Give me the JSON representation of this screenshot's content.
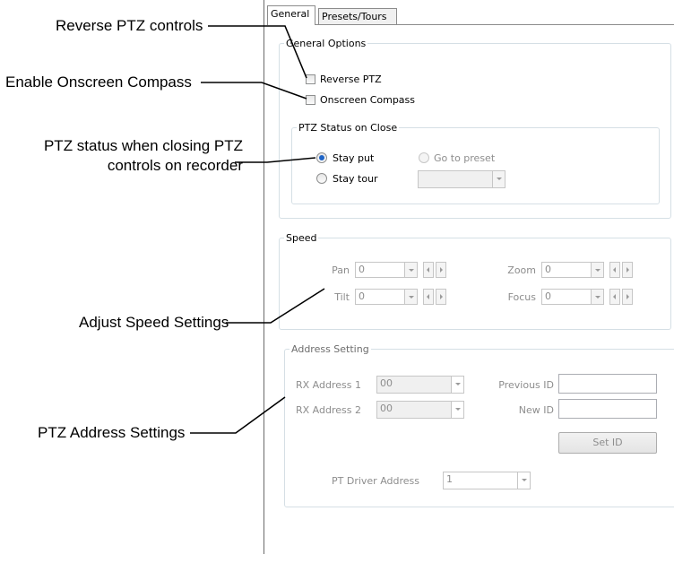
{
  "tabs": [
    {
      "label": "General",
      "active": true
    },
    {
      "label": "Presets/Tours",
      "active": false
    }
  ],
  "callouts": {
    "reverse_ptz": "Reverse PTZ controls",
    "compass": "Enable Onscreen Compass",
    "status_line1": "PTZ status when closing PTZ",
    "status_line2": "controls on recorder",
    "speed": "Adjust Speed Settings",
    "address": "PTZ Address Settings"
  },
  "general_options": {
    "title": "General Options",
    "reverse_ptz": {
      "label": "Reverse PTZ",
      "checked": false
    },
    "onscreen_compass": {
      "label": "Onscreen Compass",
      "checked": false
    },
    "status_on_close": {
      "title": "PTZ Status on Close",
      "stay_put": {
        "label": "Stay put",
        "selected": true
      },
      "go_to_preset": {
        "label": "Go to preset",
        "selected": false
      },
      "stay_tour": {
        "label": "Stay tour",
        "selected": false
      },
      "tour_select_value": ""
    }
  },
  "speed": {
    "title": "Speed",
    "pan": {
      "label": "Pan",
      "value": "0"
    },
    "tilt": {
      "label": "Tilt",
      "value": "0"
    },
    "zoom": {
      "label": "Zoom",
      "value": "0"
    },
    "focus": {
      "label": "Focus",
      "value": "0"
    }
  },
  "address": {
    "title": "Address Setting",
    "rx1": {
      "label": "RX Address 1",
      "value": "00"
    },
    "rx2": {
      "label": "RX Address 2",
      "value": "00"
    },
    "previous_id": {
      "label": "Previous ID",
      "value": ""
    },
    "new_id": {
      "label": "New ID",
      "value": ""
    },
    "set_id_button": "Set ID",
    "pt_driver": {
      "label": "PT Driver Address",
      "value": "1"
    }
  },
  "colors": {
    "radio_selected": "#1f64c6",
    "disabled_text": "#8d8d8d",
    "group_border": "#d5dfe5"
  }
}
